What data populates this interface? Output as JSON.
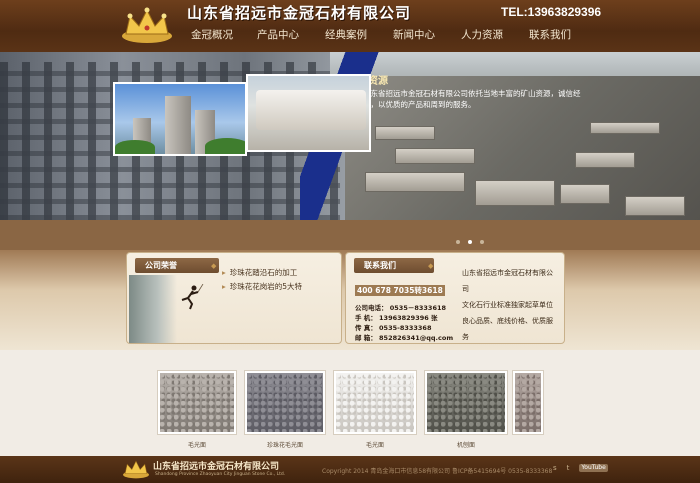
{
  "header": {
    "company_name": "山东省招远市金冠石材有限公司",
    "tel": "TEL:13963829396",
    "nav": [
      "金冠概况",
      "产品中心",
      "经典案例",
      "新闻中心",
      "人力资源",
      "联系我们"
    ]
  },
  "banner": {
    "title": "矿山资源",
    "text": "山东省招远市金冠石材有限公司依托当地丰富的矿山资源，诚信经营，以优质的产品和周到的服务。",
    "dots": 3,
    "active_dot": 1
  },
  "news": {
    "title": "公司荣誉",
    "items": [
      "珍珠花踏沿石的加工",
      "珍珠花花岗岩的5大特"
    ]
  },
  "contact": {
    "title": "联系我们",
    "phone_banner": "400 678 7035转3618",
    "lines": [
      "公司电话：  0535－8333618",
      "手    机：  13963829396 张",
      "传    真：  0535-8333368",
      "邮    箱：  852826341@qq.com"
    ]
  },
  "intro": {
    "lines": [
      "山东省招远市金冠石材有限公",
      "司",
      "文化石行业标准独家起草单位",
      "良心品质、底线价格、优质服",
      "务"
    ]
  },
  "products": [
    {
      "caption": "毛光面",
      "color_a": "#b9b3ad",
      "color_b": "#7e7872"
    },
    {
      "caption": "珍珠花毛光面",
      "color_a": "#8f8e95",
      "color_b": "#5c5b63"
    },
    {
      "caption": "毛光面",
      "color_a": "#f3f2f0",
      "color_b": "#c9c5bf"
    },
    {
      "caption": "机刨面",
      "color_a": "#8a8a82",
      "color_b": "#505049"
    },
    {
      "caption": "",
      "color_a": "#b4a9a3",
      "color_b": "#7b6e69"
    }
  ],
  "footer": {
    "name": "山东省招远市金冠石材有限公司",
    "name_en": "Shandong Province Zhaoyuan City Jinguan Stone Co., Ltd.",
    "copyright": "Copyright 2014 青岛金海口市信息58有限公司   鲁ICP备5415694号 0535-8333368",
    "socials": [
      "s",
      "t",
      "YouTube"
    ]
  },
  "colors": {
    "header_brown": "#5a3316",
    "accent_gold": "#c79a52",
    "banner_blue": "#1a2f8c"
  }
}
